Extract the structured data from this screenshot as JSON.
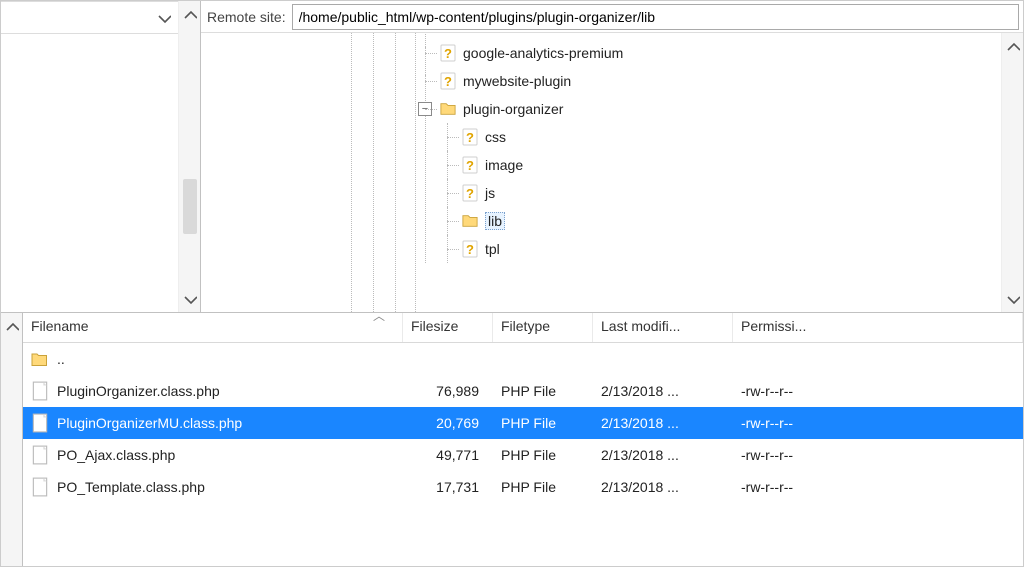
{
  "header": {
    "remote_site_label": "Remote site:",
    "remote_path": "/home/public_html/wp-content/plugins/plugin-organizer/lib"
  },
  "tree": {
    "items": [
      {
        "name": "google-analytics-premium",
        "icon": "question",
        "depth": 0
      },
      {
        "name": "mywebsite-plugin",
        "icon": "question",
        "depth": 0
      },
      {
        "name": "plugin-organizer",
        "icon": "folder",
        "depth": 0,
        "expanded": true
      },
      {
        "name": "css",
        "icon": "question",
        "depth": 1
      },
      {
        "name": "image",
        "icon": "question",
        "depth": 1
      },
      {
        "name": "js",
        "icon": "question",
        "depth": 1
      },
      {
        "name": "lib",
        "icon": "folder",
        "depth": 1,
        "selected": true
      },
      {
        "name": "tpl",
        "icon": "question",
        "depth": 1
      }
    ]
  },
  "columns": {
    "filename": "Filename",
    "filesize": "Filesize",
    "filetype": "Filetype",
    "modified": "Last modifi...",
    "perms": "Permissi..."
  },
  "files": {
    "parent_label": "..",
    "rows": [
      {
        "name": "PluginOrganizer.class.php",
        "size": "76,989",
        "type": "PHP File",
        "modified": "2/13/2018 ...",
        "perms": "-rw-r--r--",
        "selected": false
      },
      {
        "name": "PluginOrganizerMU.class.php",
        "size": "20,769",
        "type": "PHP File",
        "modified": "2/13/2018 ...",
        "perms": "-rw-r--r--",
        "selected": true
      },
      {
        "name": "PO_Ajax.class.php",
        "size": "49,771",
        "type": "PHP File",
        "modified": "2/13/2018 ...",
        "perms": "-rw-r--r--",
        "selected": false
      },
      {
        "name": "PO_Template.class.php",
        "size": "17,731",
        "type": "PHP File",
        "modified": "2/13/2018 ...",
        "perms": "-rw-r--r--",
        "selected": false
      }
    ]
  }
}
